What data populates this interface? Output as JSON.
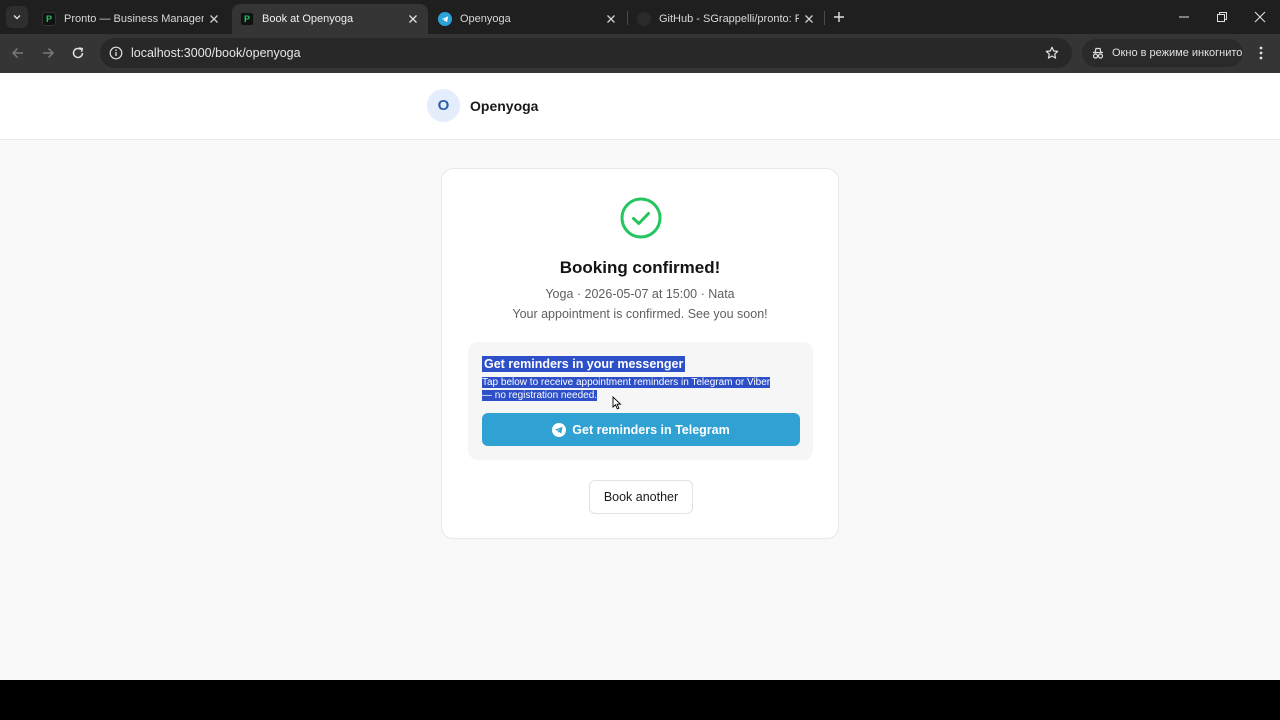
{
  "browser": {
    "tabs": [
      {
        "title": "Pronto — Business Management",
        "favicon": "pronto-p-icon",
        "active": false
      },
      {
        "title": "Book at Openyoga",
        "favicon": "pronto-p-icon",
        "active": true
      },
      {
        "title": "Openyoga",
        "favicon": "telegram-icon",
        "active": false
      },
      {
        "title": "GitHub - SGrappelli/pronto: Free",
        "favicon": "github-icon",
        "active": false
      }
    ],
    "url": "localhost:3000/book/openyoga",
    "incognito_label": "Окно в режиме инкогнито"
  },
  "site": {
    "avatar_letter": "O",
    "name": "Openyoga"
  },
  "confirmation": {
    "title": "Booking confirmed!",
    "details": "Yoga · 2026-05-07 at 15:00 · Nata",
    "message": "Your appointment is confirmed. See you soon!"
  },
  "reminders": {
    "title": "Get reminders in your messenger",
    "line1": "Tap below to receive appointment reminders in Telegram or Viber",
    "line2": "— no registration needed.",
    "telegram_button": "Get reminders in Telegram"
  },
  "actions": {
    "book_another": "Book another"
  },
  "colors": {
    "success": "#22c55e",
    "telegram": "#2fa1d2",
    "selection": "#2d4fc8"
  }
}
